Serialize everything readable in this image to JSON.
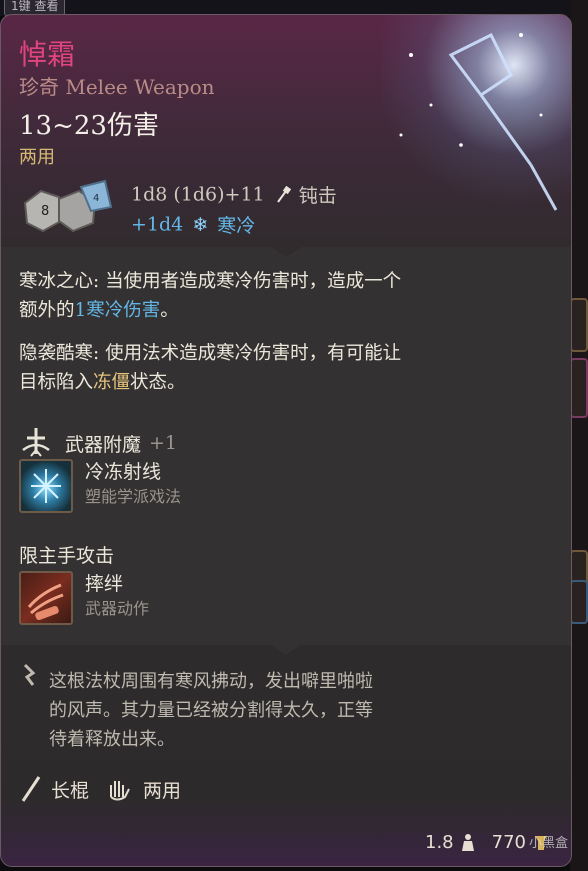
{
  "hotkey_tag": "1键 查看",
  "item": {
    "name": "悼霜",
    "subtitle": "珍奇 Melee Weapon",
    "damage_range": "13~23伤害",
    "handedness": "两用"
  },
  "damage": {
    "main_dice": "1d8 (1d6)+11",
    "main_type": "钝击",
    "main_type_icon": "blunt-damage-icon",
    "bonus_dice": "+1d4",
    "bonus_type": "寒冷",
    "bonus_type_icon": "cold-snowflake-icon"
  },
  "effects": [
    {
      "name": "寒冰之心",
      "text_pre": ": 当使用者造成寒冷伤害时，造成一个额外的",
      "highlight": "1寒冷伤害",
      "text_post": "。"
    },
    {
      "name": "隐袭酷寒",
      "text_pre": ": 使用法术造成寒冷伤害时，有可能让目标陷入",
      "highlight": "冻僵",
      "text_post": "状态。"
    }
  ],
  "enchantment": {
    "label": "武器附魔",
    "value": "+1",
    "icon": "weapon-enchant-icon"
  },
  "spells": [
    {
      "name": "冷冻射线",
      "type": "塑能学派戏法",
      "icon": "ray-of-frost-icon"
    },
    {
      "name": "摔绊",
      "type": "武器动作",
      "icon": "topple-icon"
    }
  ],
  "main_hand_label": "限主手攻击",
  "lore": "这根法杖周围有寒风拂动，发出噼里啪啦的风声。其力量已经被分割得太久，正等待着释放出来。",
  "properties": [
    {
      "label": "长棍",
      "icon": "quarterstaff-icon"
    },
    {
      "label": "两用",
      "icon": "versatile-hands-icon"
    }
  ],
  "footer": {
    "weight": "1.8",
    "value": "770",
    "watermark": "小黑盒"
  },
  "colors": {
    "name": "#e0457f",
    "cold": "#63b6e6",
    "highlight_gold": "#e5c57c",
    "handed": "#d7b873"
  }
}
